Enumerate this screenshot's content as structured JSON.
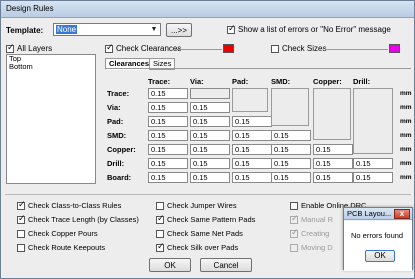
{
  "dialog": {
    "title": "Design Rules"
  },
  "template": {
    "label": "Template:",
    "value": "None",
    "arrow_button": "...>>"
  },
  "show_errors": {
    "label": "Show a list of errors or \"No Error\" message",
    "checked": true
  },
  "layers": {
    "all_label": "All Layers",
    "all_checked": true,
    "items": [
      "Top",
      "Bottom"
    ]
  },
  "check_clearances": {
    "label": "Check Clearances",
    "checked": true,
    "color": "#ee0000"
  },
  "check_sizes": {
    "label": "Check Sizes",
    "checked": false,
    "color": "#ee00ee"
  },
  "tabs": [
    {
      "label": "Clearances",
      "active": true
    },
    {
      "label": "Sizes",
      "active": false
    }
  ],
  "grid": {
    "columns": [
      "Trace:",
      "Via:",
      "Pad:",
      "SMD:",
      "Copper:",
      "Drill:"
    ],
    "unit": "mm",
    "rows": [
      {
        "label": "Trace:",
        "values": [
          "0.15",
          "",
          "",
          "",
          "",
          ""
        ]
      },
      {
        "label": "Via:",
        "values": [
          "0.15",
          "0.15",
          "",
          "",
          "",
          ""
        ]
      },
      {
        "label": "Pad:",
        "values": [
          "0.15",
          "0.15",
          "0.15",
          "",
          "",
          ""
        ]
      },
      {
        "label": "SMD:",
        "values": [
          "0.15",
          "0.15",
          "0.15",
          "0.15",
          "",
          ""
        ]
      },
      {
        "label": "Copper:",
        "values": [
          "0.15",
          "0.15",
          "0.15",
          "0.15",
          "0.15",
          ""
        ]
      },
      {
        "label": "Drill:",
        "values": [
          "0.15",
          "0.15",
          "0.15",
          "0.15",
          "0.15",
          "0.15"
        ]
      },
      {
        "label": "Board:",
        "values": [
          "0.15",
          "0.15",
          "0.15",
          "0.15",
          "0.15",
          "0.15"
        ]
      }
    ]
  },
  "options": {
    "col1": [
      {
        "label": "Check Class-to-Class Rules",
        "checked": true
      },
      {
        "label": "Check Trace Length (by Classes)",
        "checked": true
      },
      {
        "label": "Check Copper Pours",
        "checked": false
      },
      {
        "label": "Check Route Keepouts",
        "checked": false
      }
    ],
    "col2": [
      {
        "label": "Check Jumper Wires",
        "checked": false
      },
      {
        "label": "Check Same Pattern Pads",
        "checked": true
      },
      {
        "label": "Check Same Net Pads",
        "checked": false
      },
      {
        "label": "Check Silk over Pads",
        "checked": true
      }
    ],
    "col3": [
      {
        "label": "Enable Online DRC",
        "checked": false,
        "disabled": false
      },
      {
        "label": "Manual R",
        "checked": true,
        "disabled": true
      },
      {
        "label": "Creating",
        "checked": true,
        "disabled": true
      },
      {
        "label": "Moving D",
        "checked": false,
        "disabled": true
      }
    ]
  },
  "buttons": {
    "ok": "OK",
    "cancel": "Cancel"
  },
  "popup": {
    "title": "PCB Layou...",
    "close": "x",
    "message": "No errors found",
    "ok": "OK"
  }
}
